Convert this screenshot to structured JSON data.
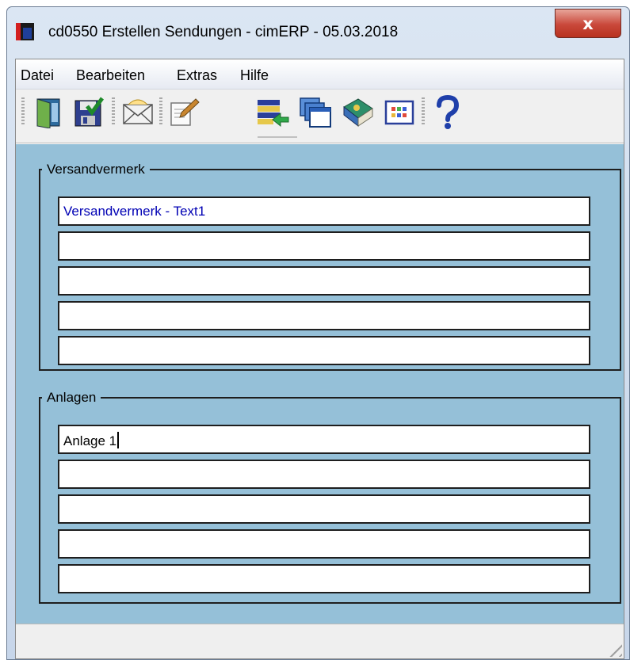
{
  "window": {
    "title": "cd0550 Erstellen Sendungen - cimERP - 05.03.2018",
    "close_glyph": "x"
  },
  "menu": {
    "items": [
      {
        "label": "Datei"
      },
      {
        "label": "Bearbeiten"
      },
      {
        "label": "Extras"
      },
      {
        "label": "Hilfe"
      }
    ]
  },
  "toolbar": {
    "buttons": [
      {
        "icon": "exit-door-icon"
      },
      {
        "icon": "save-icon"
      },
      {
        "icon": "envelope-icon"
      },
      {
        "icon": "edit-document-icon"
      },
      {
        "icon": "list-transfer-icon"
      },
      {
        "icon": "windows-cascade-icon"
      },
      {
        "icon": "book-icon"
      },
      {
        "icon": "grid-icon"
      },
      {
        "icon": "help-icon"
      }
    ]
  },
  "versandvermerk": {
    "label": "Versandvermerk",
    "lines": [
      "Versandvermerk - Text1",
      "",
      "",
      "",
      ""
    ]
  },
  "anlagen": {
    "label": "Anlagen",
    "lines": [
      "Anlage 1",
      "",
      "",
      "",
      ""
    ]
  },
  "colors": {
    "workarea": "#95c0d8",
    "field_text": "#0000b4"
  }
}
